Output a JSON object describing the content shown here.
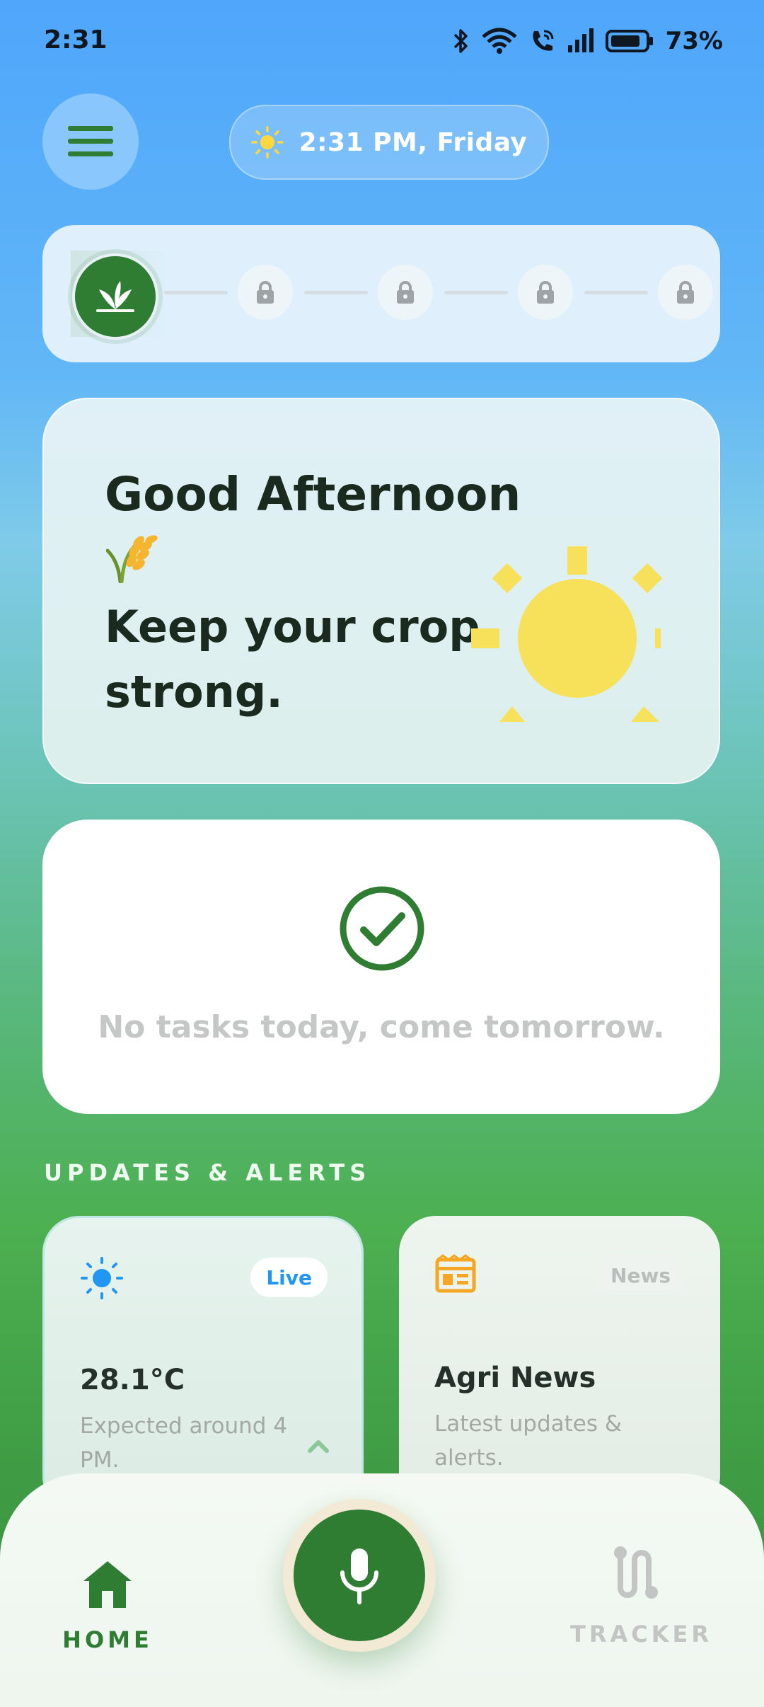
{
  "status_bar": {
    "time": "2:31",
    "battery": "73%",
    "icons": [
      "bluetooth-icon",
      "wifi-icon",
      "wifi-call-icon",
      "signal-icon",
      "battery-icon"
    ]
  },
  "header": {
    "menu_icon": "menu-icon",
    "time_pill": {
      "icon": "sun-icon",
      "text": "2:31 PM, Friday"
    }
  },
  "progress": {
    "active_icon": "sprout-icon",
    "locked_steps": 4,
    "lock_icon": "lock-icon"
  },
  "greeting": {
    "title": "Good Afternoon",
    "emoji": "rice-plant-icon",
    "subtitle": "Keep your crop strong."
  },
  "tasks": {
    "icon": "check-circle-icon",
    "message": "No tasks today, come tomorrow."
  },
  "updates": {
    "section_title": "UPDATES & ALERTS",
    "cards": [
      {
        "icon": "sun-icon",
        "badge": "Live",
        "title": "28.1°C",
        "description": "Expected around 4 PM."
      },
      {
        "icon": "newspaper-icon",
        "badge": "News",
        "title": "Agri News",
        "description": "Latest updates & alerts."
      }
    ]
  },
  "bottom_nav": {
    "home_label": "HOME",
    "tracker_label": "TRACKER",
    "mic_icon": "microphone-icon"
  },
  "colors": {
    "primary_green": "#2e7d32",
    "live_blue": "#2196f3",
    "news_orange": "#f5a623",
    "sun_yellow": "#f7e05a"
  }
}
